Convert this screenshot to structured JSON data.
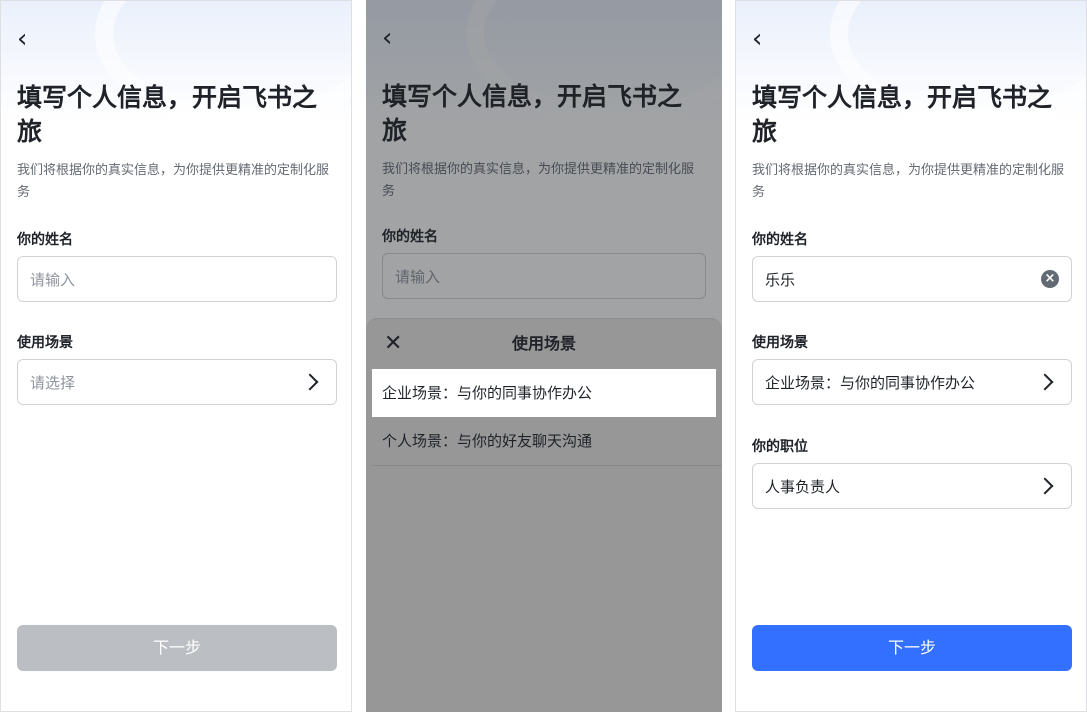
{
  "common": {
    "back_icon": "chevron-left-icon",
    "title": "填写个人信息，开启飞书之旅",
    "subtitle": "我们将根据你的真实信息，为你提供更精准的定制化服务",
    "name_label": "你的姓名",
    "scene_label": "使用场景",
    "next_label": "下一步"
  },
  "screen1": {
    "name_placeholder": "请输入",
    "scene_placeholder": "请选择"
  },
  "screen2": {
    "name_placeholder": "请输入",
    "sheet_title": "使用场景",
    "options": [
      "企业场景：与你的同事协作办公",
      "个人场景：与你的好友聊天沟通"
    ]
  },
  "screen3": {
    "name_value": "乐乐",
    "scene_value": "企业场景：与你的同事协作办公",
    "position_label": "你的职位",
    "position_value": "人事负责人"
  },
  "colors": {
    "primary": "#3370ff",
    "disabled_button": "#bbbfc4",
    "placeholder": "#8f959e",
    "text": "#1f2329"
  }
}
